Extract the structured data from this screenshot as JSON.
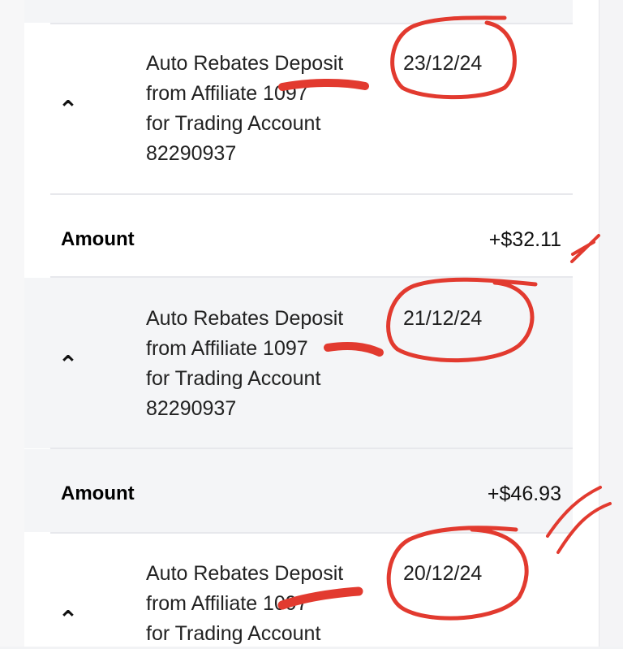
{
  "transactions": [
    {
      "title": "Auto Rebates Deposit",
      "line2": "from Affiliate 1097",
      "line3": "for Trading Account",
      "account": "82290937",
      "date": "23/12/24",
      "amount_label": "Amount",
      "amount": "+$32.11"
    },
    {
      "title": "Auto Rebates Deposit",
      "line2": "from Affiliate 1097",
      "line3": "for Trading Account",
      "account": "82290937",
      "date": "21/12/24",
      "amount_label": "Amount",
      "amount": "+$46.93"
    },
    {
      "title": "Auto Rebates Deposit",
      "line2": "from Affiliate 1097",
      "line3": "for Trading Account",
      "date": "20/12/24"
    }
  ],
  "icons": {
    "expand": "chevron-up-icon"
  },
  "colors": {
    "annotation": "#e23a2f",
    "shaded_row": "#f4f5f7",
    "divider": "#e7e8ec"
  }
}
